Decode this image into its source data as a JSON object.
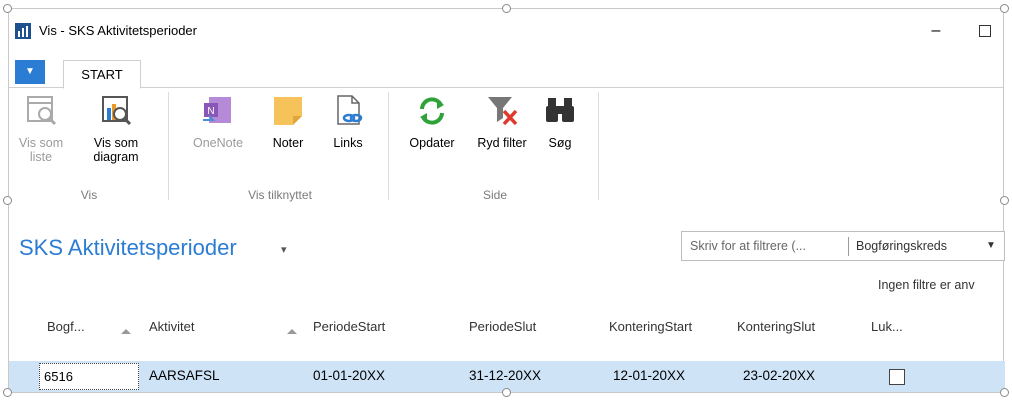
{
  "window": {
    "title": "Vis - SKS Aktivitetsperioder",
    "minimize": "–"
  },
  "ribbon": {
    "tab": "START",
    "groups": [
      {
        "label": "Vis",
        "buttons": [
          {
            "label": "Vis som liste",
            "icon": "list-view-icon",
            "disabled": true
          },
          {
            "label": "Vis som diagram",
            "icon": "chart-view-icon",
            "disabled": false
          }
        ]
      },
      {
        "label": "Vis tilknyttet",
        "buttons": [
          {
            "label": "OneNote",
            "icon": "onenote-icon",
            "disabled": true
          },
          {
            "label": "Noter",
            "icon": "note-icon",
            "disabled": false
          },
          {
            "label": "Links",
            "icon": "links-icon",
            "disabled": false
          }
        ]
      },
      {
        "label": "Side",
        "buttons": [
          {
            "label": "Opdater",
            "icon": "refresh-icon",
            "disabled": false
          },
          {
            "label": "Ryd filter",
            "icon": "clear-filter-icon",
            "disabled": false
          },
          {
            "label": "Søg",
            "icon": "binoculars-icon",
            "disabled": false
          }
        ]
      }
    ]
  },
  "page": {
    "title": "SKS Aktivitetsperioder",
    "filter_placeholder": "Skriv for at filtrere (...",
    "filter_field": "Bogføringskreds",
    "no_filter_text": "Ingen filtre er anv"
  },
  "grid": {
    "columns": [
      "Bogf...",
      "Aktivitet",
      "PeriodeStart",
      "PeriodeSlut",
      "KonteringStart",
      "KonteringSlut",
      "Luk..."
    ],
    "rows": [
      [
        "6516",
        "AARSAFSL",
        "01-01-20XX",
        "31-12-20XX",
        "12-01-20XX",
        "23-02-20XX",
        ""
      ]
    ],
    "row_checked": false
  },
  "colors": {
    "accent": "#2b7cd3",
    "selected_row": "#cfe3f7"
  }
}
